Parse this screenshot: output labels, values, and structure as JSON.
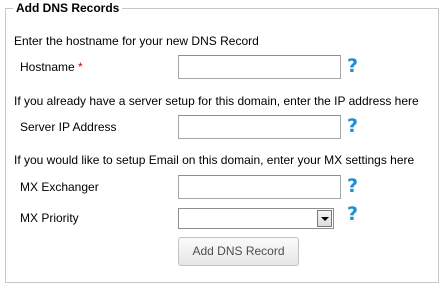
{
  "panel": {
    "title": "Add DNS Records"
  },
  "sections": {
    "hostname_intro": "Enter the hostname for your new DNS Record",
    "ip_intro": "If you already have a server setup for this domain, enter the IP address here",
    "email_intro": "If you would like to setup Email on this domain, enter your MX settings here"
  },
  "fields": {
    "hostname": {
      "label": "Hostname",
      "required_marker": "*",
      "value": ""
    },
    "server_ip": {
      "label": "Server IP Address",
      "value": ""
    },
    "mx_exchanger": {
      "label": "MX Exchanger",
      "value": ""
    },
    "mx_priority": {
      "label": "MX Priority",
      "selected": ""
    }
  },
  "help": {
    "glyph": "?"
  },
  "buttons": {
    "submit_label": "Add DNS Record"
  },
  "colors": {
    "help_icon": "#1d8fd1",
    "required_marker": "#cc0000",
    "border": "#c7c7c7"
  }
}
